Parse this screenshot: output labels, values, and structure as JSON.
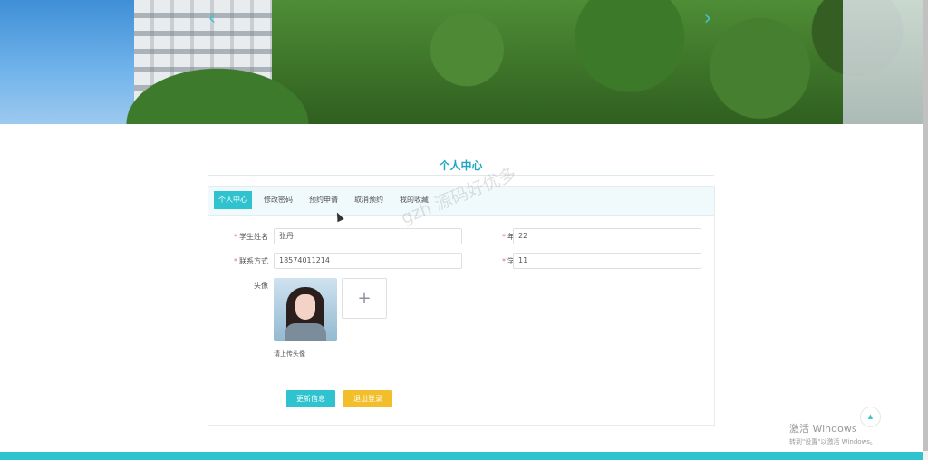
{
  "banner": {
    "prev_icon": "chevron-left-icon",
    "next_icon": "chevron-right-icon",
    "prev_glyph": "‹",
    "next_glyph": "›"
  },
  "section": {
    "title": "个人中心"
  },
  "tabs": [
    {
      "label": "个人中心",
      "active": true
    },
    {
      "label": "修改密码",
      "active": false
    },
    {
      "label": "预约申请",
      "active": false
    },
    {
      "label": "取消预约",
      "active": false
    },
    {
      "label": "我的收藏",
      "active": false
    }
  ],
  "form": {
    "name": {
      "label": "学生姓名",
      "value": "张丹"
    },
    "age": {
      "label": "年龄",
      "value": "22"
    },
    "phone": {
      "label": "联系方式",
      "value": "18574011214"
    },
    "student_id": {
      "label": "学号",
      "value": "11"
    },
    "avatar": {
      "label": "头像",
      "hint": "请上传头像",
      "upload_glyph": "+"
    }
  },
  "buttons": {
    "update": "更新信息",
    "logout": "退出登录"
  },
  "watermark": "gzh 源码好优多",
  "back_to_top": {
    "icon": "arrow-up-icon",
    "glyph": "▲"
  },
  "windows_activation": {
    "line1": "激活 Windows",
    "line2": "转到\"设置\"以激活 Windows。"
  },
  "colors": {
    "accent": "#2fc3cf",
    "warning_button": "#f2be2c",
    "title": "#1fa7c0",
    "required": "#f26a6a"
  }
}
